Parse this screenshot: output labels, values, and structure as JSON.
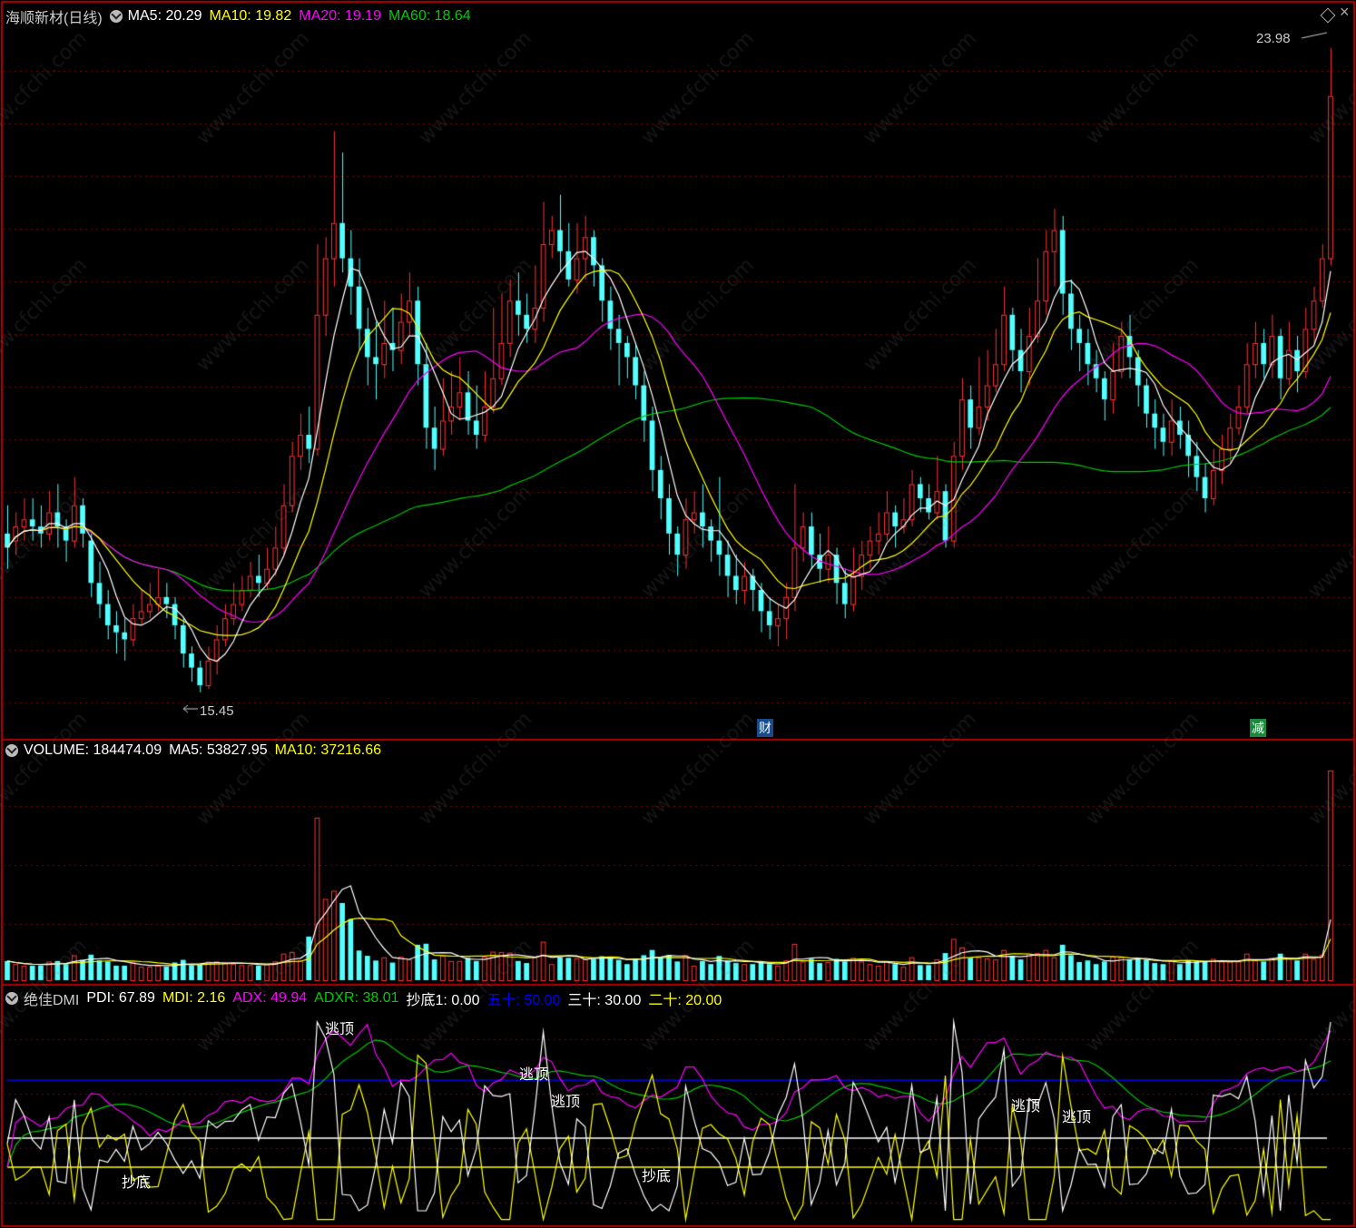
{
  "main": {
    "title": "海顺新材(日线)",
    "ma5": "MA5: 20.29",
    "ma10": "MA10: 19.82",
    "ma20": "MA20: 19.19",
    "ma60": "MA60: 18.64",
    "high_label": "23.98",
    "low_label": "15.45",
    "event_cai": "财",
    "event_jian": "减"
  },
  "volume": {
    "title": "VOLUME: 184474.09",
    "ma5": "MA5: 53827.95",
    "ma10": "MA10: 37216.66"
  },
  "dmi": {
    "title": "绝佳DMI",
    "pdi": "PDI: 67.89",
    "mdi": "MDI: 2.16",
    "adx": "ADX: 49.94",
    "adxr": "ADXR: 38.01",
    "chaodi1": "抄底1: 0.00",
    "wushi": "五十: 50.00",
    "sanshi": "三十: 30.00",
    "ershi": "二十: 20.00",
    "signals": [
      "逃顶",
      "逃顶",
      "逃顶",
      "逃顶",
      "逃顶",
      "抄底",
      "抄底"
    ]
  },
  "colors": {
    "up": "#ff3232",
    "down": "#54ffff",
    "ma5": "#ffffff",
    "ma10": "#ffff00",
    "ma20": "#ff00ff",
    "ma60": "#00c800",
    "fifty": "#0000ff",
    "grid": "#800000"
  },
  "chart_data": {
    "type": "candlestick",
    "price_range": [
      15.45,
      23.98
    ],
    "candles": [
      [
        17.1,
        16.9,
        17.5,
        16.6
      ],
      [
        17.0,
        17.2,
        17.4,
        16.8
      ],
      [
        17.2,
        17.3,
        17.6,
        17.0
      ],
      [
        17.3,
        17.2,
        17.6,
        17.0
      ],
      [
        17.2,
        17.1,
        17.5,
        16.9
      ],
      [
        17.1,
        17.4,
        17.7,
        17.0
      ],
      [
        17.4,
        17.2,
        17.8,
        16.9
      ],
      [
        17.2,
        17.0,
        17.3,
        16.7
      ],
      [
        17.0,
        17.5,
        17.9,
        16.9
      ],
      [
        17.5,
        17.1,
        17.6,
        16.9
      ],
      [
        17.0,
        16.4,
        17.1,
        16.2
      ],
      [
        16.4,
        16.1,
        16.7,
        15.9
      ],
      [
        16.1,
        15.8,
        16.3,
        15.6
      ],
      [
        15.8,
        15.7,
        16.0,
        15.4
      ],
      [
        15.7,
        15.6,
        15.9,
        15.3
      ],
      [
        15.6,
        15.9,
        16.1,
        15.5
      ],
      [
        15.9,
        16.0,
        16.3,
        15.8
      ],
      [
        16.0,
        16.1,
        16.4,
        15.9
      ],
      [
        16.1,
        16.2,
        16.6,
        16.0
      ],
      [
        16.2,
        16.1,
        16.4,
        15.9
      ],
      [
        16.1,
        15.8,
        16.2,
        15.6
      ],
      [
        15.8,
        15.4,
        15.9,
        15.2
      ],
      [
        15.4,
        15.2,
        15.5,
        15.0
      ],
      [
        15.2,
        14.95,
        15.3,
        14.85
      ],
      [
        14.95,
        15.3,
        15.5,
        14.9
      ],
      [
        15.3,
        15.6,
        15.8,
        15.1
      ],
      [
        15.6,
        15.9,
        16.1,
        15.5
      ],
      [
        15.9,
        16.1,
        16.4,
        15.8
      ],
      [
        16.1,
        16.3,
        16.5,
        16.0
      ],
      [
        16.3,
        16.5,
        16.7,
        16.2
      ],
      [
        16.5,
        16.4,
        16.8,
        16.2
      ],
      [
        16.4,
        16.6,
        16.9,
        16.3
      ],
      [
        16.6,
        16.9,
        17.2,
        16.5
      ],
      [
        16.9,
        17.5,
        17.8,
        16.8
      ],
      [
        17.5,
        18.2,
        18.4,
        17.4
      ],
      [
        18.2,
        18.5,
        18.8,
        18.0
      ],
      [
        18.5,
        18.3,
        18.9,
        18.1
      ],
      [
        18.3,
        20.2,
        21.2,
        18.2
      ],
      [
        20.2,
        21.0,
        21.3,
        19.9
      ],
      [
        21.0,
        21.5,
        22.8,
        20.6
      ],
      [
        21.5,
        21.0,
        22.5,
        20.8
      ],
      [
        21.0,
        20.6,
        21.4,
        20.2
      ],
      [
        20.6,
        20.0,
        21.0,
        19.7
      ],
      [
        20.0,
        19.6,
        20.3,
        19.2
      ],
      [
        19.6,
        19.5,
        20.1,
        19.0
      ],
      [
        19.5,
        19.8,
        20.4,
        19.3
      ],
      [
        19.8,
        19.7,
        20.3,
        19.4
      ],
      [
        19.7,
        20.1,
        20.5,
        19.5
      ],
      [
        20.1,
        20.4,
        20.8,
        19.9
      ],
      [
        20.4,
        19.5,
        20.6,
        19.2
      ],
      [
        19.5,
        18.6,
        19.8,
        18.3
      ],
      [
        18.6,
        18.3,
        18.9,
        18.0
      ],
      [
        18.3,
        18.7,
        19.3,
        18.2
      ],
      [
        18.7,
        18.9,
        19.4,
        18.5
      ],
      [
        18.9,
        19.1,
        19.6,
        18.7
      ],
      [
        19.1,
        18.7,
        19.4,
        18.5
      ],
      [
        18.7,
        18.5,
        19.2,
        18.3
      ],
      [
        18.5,
        18.9,
        19.4,
        18.4
      ],
      [
        18.9,
        19.3,
        20.3,
        18.8
      ],
      [
        19.3,
        19.8,
        20.5,
        19.2
      ],
      [
        19.8,
        20.4,
        20.7,
        19.6
      ],
      [
        20.4,
        20.2,
        20.8,
        19.9
      ],
      [
        20.2,
        20.0,
        20.5,
        19.8
      ],
      [
        20.0,
        20.3,
        20.9,
        19.8
      ],
      [
        20.3,
        21.2,
        21.8,
        20.1
      ],
      [
        21.2,
        21.4,
        21.6,
        21.0
      ],
      [
        21.4,
        21.1,
        21.9,
        20.8
      ],
      [
        21.1,
        20.7,
        21.5,
        20.6
      ],
      [
        20.7,
        21.0,
        21.5,
        20.5
      ],
      [
        21.0,
        21.3,
        21.6,
        20.7
      ],
      [
        21.3,
        20.9,
        21.4,
        20.6
      ],
      [
        20.9,
        20.4,
        21.0,
        20.1
      ],
      [
        20.4,
        20.0,
        20.6,
        19.7
      ],
      [
        20.0,
        19.8,
        20.2,
        19.2
      ],
      [
        19.8,
        19.6,
        19.9,
        19.3
      ],
      [
        19.6,
        19.2,
        19.8,
        19.0
      ],
      [
        19.2,
        18.7,
        19.4,
        18.4
      ],
      [
        18.7,
        18.0,
        18.9,
        17.7
      ],
      [
        18.0,
        17.6,
        18.2,
        17.3
      ],
      [
        17.6,
        17.1,
        17.8,
        16.8
      ],
      [
        17.1,
        16.8,
        17.2,
        16.5
      ],
      [
        16.8,
        17.3,
        17.6,
        16.6
      ],
      [
        17.3,
        17.4,
        17.7,
        17.1
      ],
      [
        17.4,
        17.2,
        17.8,
        16.9
      ],
      [
        17.2,
        17.0,
        17.3,
        16.7
      ],
      [
        17.0,
        16.8,
        17.9,
        16.5
      ],
      [
        16.8,
        16.5,
        17.0,
        16.2
      ],
      [
        16.5,
        16.3,
        16.8,
        16.1
      ],
      [
        16.3,
        16.5,
        16.7,
        16.1
      ],
      [
        16.5,
        16.3,
        16.6,
        16.0
      ],
      [
        16.3,
        16.0,
        16.4,
        15.7
      ],
      [
        16.0,
        15.8,
        16.2,
        15.6
      ],
      [
        15.8,
        15.9,
        16.1,
        15.5
      ],
      [
        15.9,
        16.2,
        16.4,
        15.6
      ],
      [
        16.2,
        16.9,
        17.8,
        16.0
      ],
      [
        16.9,
        17.2,
        17.4,
        16.7
      ],
      [
        17.2,
        16.8,
        17.4,
        16.6
      ],
      [
        16.8,
        16.6,
        17.1,
        16.4
      ],
      [
        16.6,
        16.8,
        17.2,
        16.4
      ],
      [
        16.8,
        16.4,
        16.9,
        16.1
      ],
      [
        16.4,
        16.1,
        16.6,
        15.9
      ],
      [
        16.1,
        16.5,
        16.9,
        16.0
      ],
      [
        16.5,
        16.8,
        17.0,
        16.3
      ],
      [
        16.8,
        17.0,
        17.2,
        16.6
      ],
      [
        17.0,
        17.1,
        17.4,
        16.8
      ],
      [
        17.1,
        17.4,
        17.7,
        17.0
      ],
      [
        17.4,
        17.2,
        17.5,
        16.9
      ],
      [
        17.2,
        17.3,
        17.6,
        17.1
      ],
      [
        17.3,
        17.8,
        18.0,
        17.2
      ],
      [
        17.8,
        17.6,
        17.9,
        17.4
      ],
      [
        17.6,
        17.4,
        17.8,
        17.3
      ],
      [
        17.4,
        17.7,
        18.2,
        17.3
      ],
      [
        17.7,
        17.0,
        17.8,
        16.9
      ],
      [
        17.0,
        18.2,
        18.4,
        16.9
      ],
      [
        18.2,
        19.0,
        19.3,
        18.0
      ],
      [
        19.0,
        18.6,
        19.2,
        18.3
      ],
      [
        18.6,
        18.9,
        19.6,
        18.5
      ],
      [
        18.9,
        19.2,
        19.7,
        18.7
      ],
      [
        19.2,
        19.5,
        20.0,
        19.1
      ],
      [
        19.5,
        20.2,
        20.6,
        19.4
      ],
      [
        20.2,
        19.7,
        20.3,
        19.4
      ],
      [
        19.7,
        19.4,
        20.0,
        19.1
      ],
      [
        19.4,
        19.9,
        20.3,
        19.2
      ],
      [
        19.9,
        20.4,
        21.0,
        19.8
      ],
      [
        20.4,
        21.1,
        21.4,
        20.2
      ],
      [
        21.1,
        21.4,
        21.7,
        20.6
      ],
      [
        21.4,
        20.5,
        21.6,
        20.2
      ],
      [
        20.5,
        20.0,
        20.7,
        19.7
      ],
      [
        20.0,
        19.8,
        20.2,
        19.4
      ],
      [
        19.8,
        19.5,
        20.0,
        19.2
      ],
      [
        19.5,
        19.3,
        19.7,
        19.1
      ],
      [
        19.3,
        19.0,
        19.4,
        18.7
      ],
      [
        19.0,
        19.4,
        19.8,
        18.8
      ],
      [
        19.4,
        19.9,
        20.1,
        19.3
      ],
      [
        19.9,
        19.6,
        20.2,
        19.3
      ],
      [
        19.6,
        19.2,
        19.7,
        18.9
      ],
      [
        19.2,
        18.8,
        19.3,
        18.6
      ],
      [
        18.8,
        18.6,
        19.0,
        18.3
      ],
      [
        18.6,
        18.4,
        18.8,
        18.2
      ],
      [
        18.4,
        18.7,
        19.0,
        18.2
      ],
      [
        18.7,
        18.5,
        18.9,
        18.3
      ],
      [
        18.5,
        18.2,
        18.7,
        17.9
      ],
      [
        18.2,
        17.9,
        18.4,
        17.7
      ],
      [
        17.9,
        17.6,
        18.1,
        17.4
      ],
      [
        17.6,
        18.0,
        18.3,
        17.5
      ],
      [
        18.0,
        18.3,
        18.5,
        17.8
      ],
      [
        18.3,
        18.6,
        18.8,
        18.1
      ],
      [
        18.6,
        18.9,
        19.2,
        18.5
      ],
      [
        18.9,
        19.5,
        19.8,
        18.8
      ],
      [
        19.5,
        19.8,
        20.1,
        19.3
      ],
      [
        19.8,
        19.5,
        20.0,
        19.3
      ],
      [
        19.5,
        19.9,
        20.2,
        19.3
      ],
      [
        19.9,
        19.3,
        20.0,
        19.0
      ],
      [
        19.3,
        19.7,
        20.1,
        19.2
      ],
      [
        19.7,
        19.4,
        19.9,
        19.1
      ],
      [
        19.4,
        20.0,
        20.3,
        19.3
      ],
      [
        20.0,
        20.4,
        20.6,
        19.8
      ],
      [
        20.4,
        21.0,
        21.2,
        20.3
      ],
      [
        21.0,
        23.3,
        23.98,
        20.9
      ]
    ]
  }
}
